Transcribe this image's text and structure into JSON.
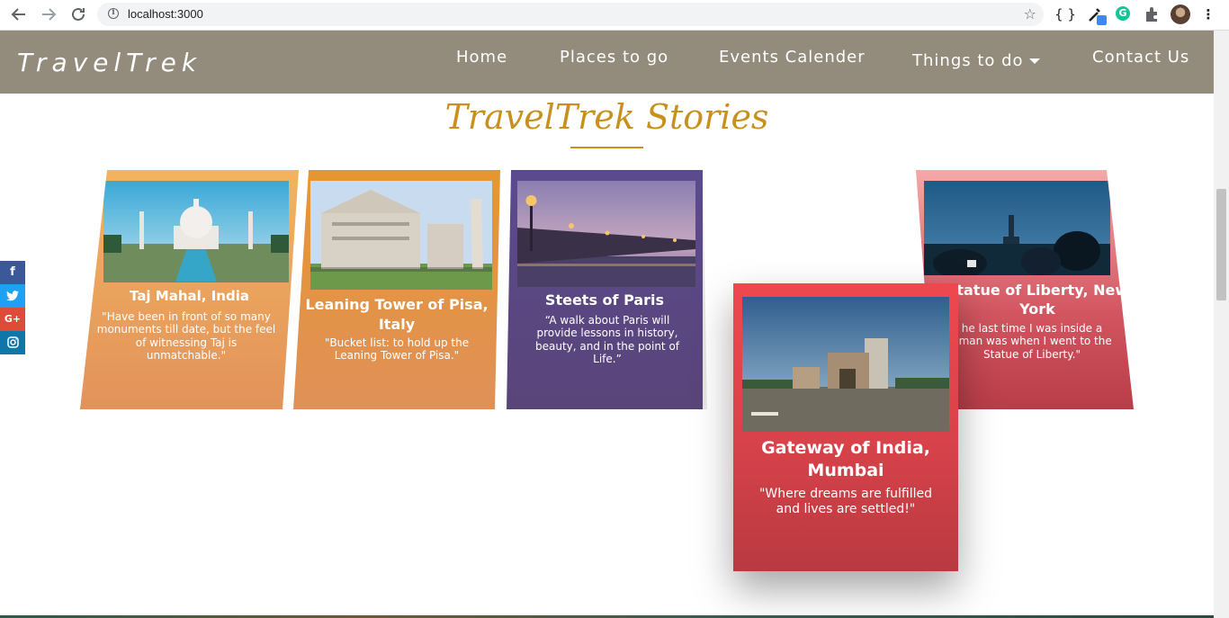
{
  "browser": {
    "url": "localhost:3000",
    "back_icon": "arrow-left-icon",
    "forward_icon": "arrow-right-icon",
    "reload_icon": "reload-icon",
    "bookmark_icon": "star-icon",
    "ext_braces": "{ }"
  },
  "header": {
    "brand": "TravelTrek",
    "nav": {
      "home": "Home",
      "places": "Places to go",
      "events": "Events Calender",
      "things": "Things to do",
      "contact": "Contact Us"
    },
    "background": "#938b7b"
  },
  "section": {
    "title": "TravelTrek Stories",
    "accent": "#c8911f"
  },
  "social": {
    "facebook": "f",
    "twitter": "t",
    "google_plus": "G+",
    "instagram": "◎",
    "colors": {
      "facebook": "#3b5998",
      "twitter": "#1da1f2",
      "google_plus": "#dd4b39",
      "instagram": "#0e76a8"
    }
  },
  "cards": {
    "taj": {
      "title": "Taj Mahal, India",
      "quote": "\"Have been in front of so many monuments till date, but the feel of witnessing Taj is unmatchable.\""
    },
    "pisa": {
      "title": "Leaning Tower of Pisa, Italy",
      "quote": "\"Bucket list: to hold up the Leaning Tower of Pisa.\""
    },
    "paris": {
      "title": "Steets of Paris",
      "quote": "“A walk about Paris will provide lessons in history, beauty, and in the point of Life.”"
    },
    "liberty": {
      "title": "Statue of Liberty, New York",
      "quote": "he last time I was inside a oman was when I went to the Statue of Liberty.\""
    },
    "gateway": {
      "title": "Gateway of India, Mumbai",
      "quote": "\"Where dreams are fulfilled and lives are settled!\""
    }
  }
}
